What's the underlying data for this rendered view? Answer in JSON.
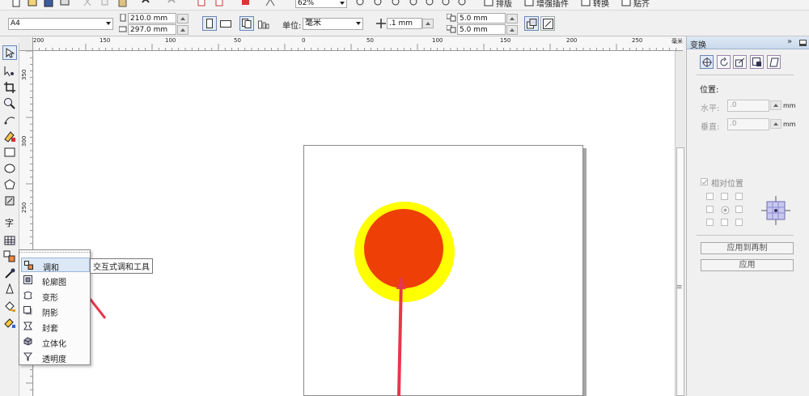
{
  "toolbar": {
    "zoom": "62%",
    "menus": [
      "排版",
      "增强插件",
      "转换",
      "贴齐"
    ]
  },
  "property_bar": {
    "page_size": "A4",
    "width": "210.0 mm",
    "height": "297.0 mm",
    "unit_label": "单位:",
    "unit": "毫米",
    "nudge": ".1 mm",
    "dup_x": "5.0 mm",
    "dup_y": "5.0 mm"
  },
  "ruler": {
    "h_labels": [
      "200",
      "150",
      "100",
      "50",
      "0",
      "50",
      "100",
      "150",
      "200",
      "250"
    ],
    "h_unit": "毫米",
    "v_labels": [
      "350",
      "300",
      "250"
    ]
  },
  "flyout": {
    "items": [
      "调和",
      "轮廓图",
      "变形",
      "阴影",
      "封套",
      "立体化",
      "透明度"
    ],
    "tooltip": "交互式调和工具"
  },
  "text_tool_glyph": "字",
  "docker": {
    "title": "变换",
    "position_label": "位置:",
    "horizontal_label": "水平:",
    "horizontal_value": ".0",
    "vertical_label": "垂直:",
    "vertical_value": ".0",
    "unit": "mm",
    "relative_position": "相对位置",
    "apply_to_duplicate": "应用到再制",
    "apply": "应用"
  },
  "colors": {
    "outer_circle": "#ffff00",
    "inner_circle": "#ee3f07",
    "arrow": "#e8364a"
  }
}
